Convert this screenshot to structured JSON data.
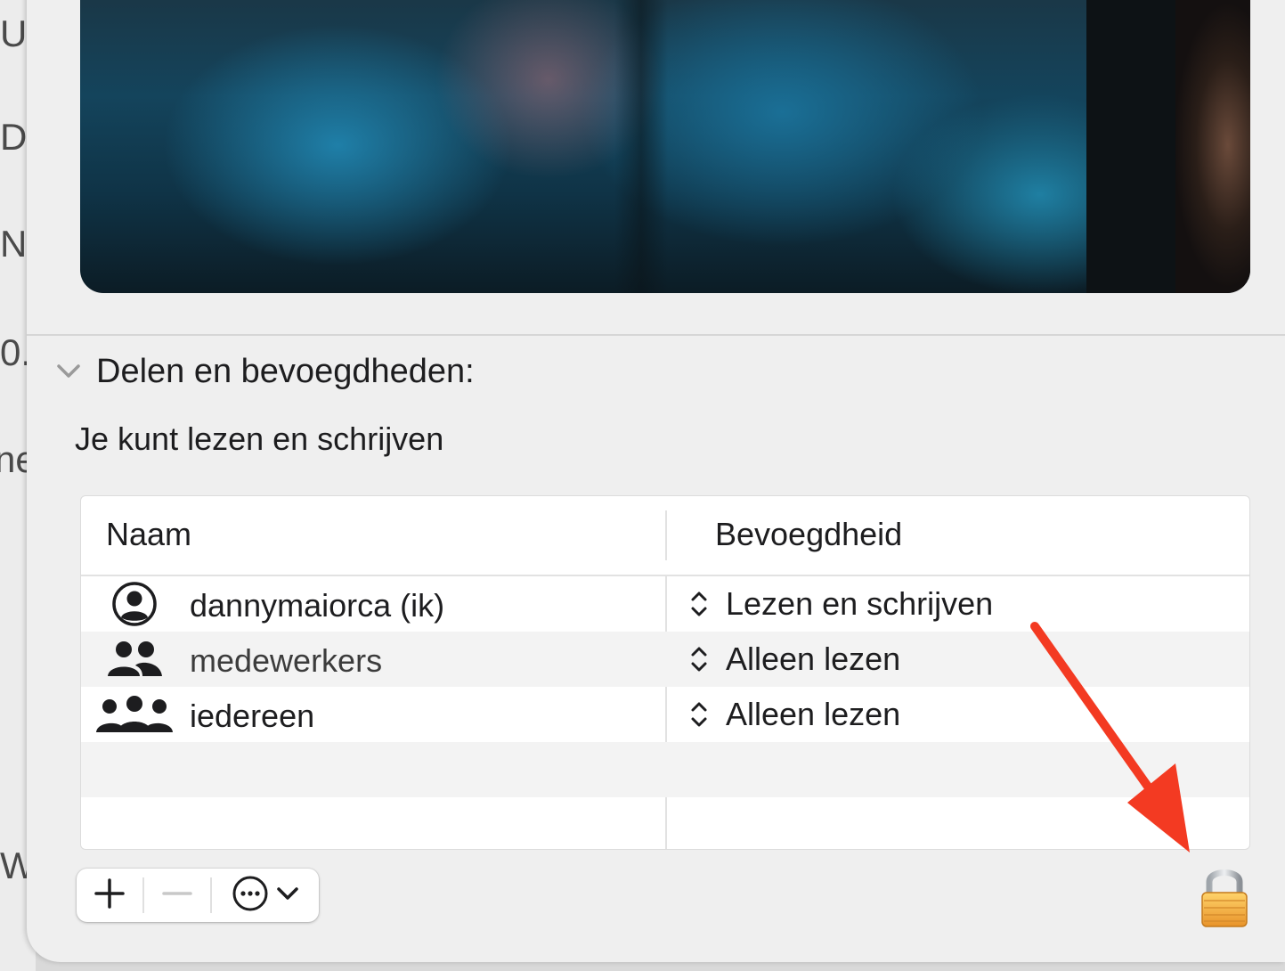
{
  "background_window": {
    "fragments": [
      "U",
      "D",
      "N",
      "0.",
      "ne",
      "W"
    ]
  },
  "section": {
    "title": "Delen en bevoegdheden:",
    "status": "Je kunt lezen en schrijven"
  },
  "table": {
    "columns": {
      "name": "Naam",
      "permission": "Bevoegdheid"
    },
    "rows": [
      {
        "icon": "user-circle-icon",
        "name": "dannymaiorca (ik)",
        "permission": "Lezen en schrijven"
      },
      {
        "icon": "group-icon",
        "name": "medewerkers",
        "permission": "Alleen lezen"
      },
      {
        "icon": "everyone-icon",
        "name": "iedereen",
        "permission": "Alleen lezen"
      }
    ]
  },
  "toolbar": {
    "add_icon": "plus-icon",
    "remove_icon": "minus-icon",
    "more_icon": "ellipsis-circle-icon",
    "dropdown_icon": "chevron-down-icon"
  },
  "colors": {
    "lock": "#f2a93b",
    "arrow": "#f33a22"
  }
}
